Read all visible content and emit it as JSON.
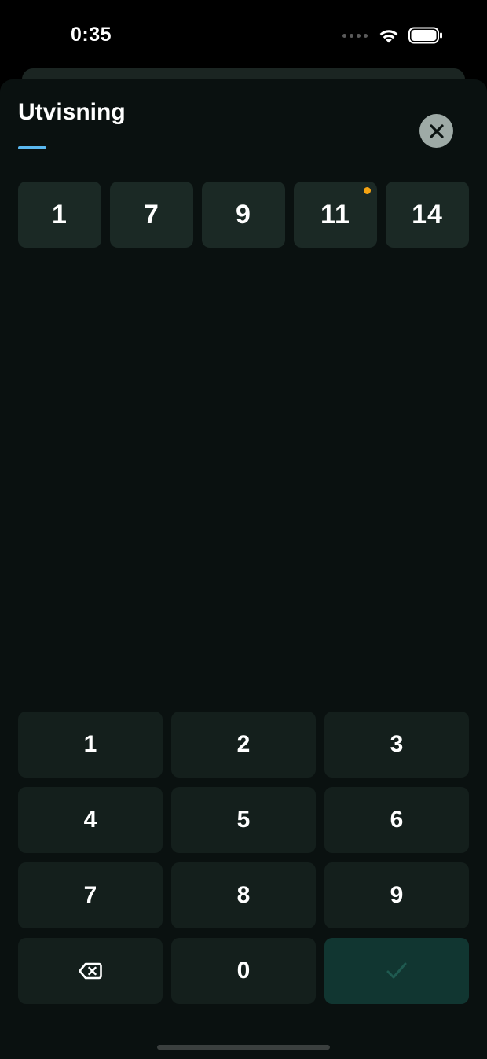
{
  "status_bar": {
    "time": "0:35",
    "icons": [
      "signal-dots-icon",
      "wifi-icon",
      "battery-icon"
    ]
  },
  "sheet": {
    "title": "Utvisning",
    "close_icon": "close-icon"
  },
  "chips": [
    {
      "label": "1",
      "has_dot": false
    },
    {
      "label": "7",
      "has_dot": false
    },
    {
      "label": "9",
      "has_dot": false
    },
    {
      "label": "11",
      "has_dot": true
    },
    {
      "label": "14",
      "has_dot": false
    }
  ],
  "keypad": {
    "digits": [
      "1",
      "2",
      "3",
      "4",
      "5",
      "6",
      "7",
      "8",
      "9"
    ],
    "zero": "0",
    "backspace_icon": "backspace-icon",
    "confirm_icon": "checkmark-icon"
  },
  "colors": {
    "accent_underline": "#5ab8f0",
    "indicator_dot": "#f5a312",
    "confirm_key": "#113631",
    "checkmark": "#1f5a50"
  }
}
